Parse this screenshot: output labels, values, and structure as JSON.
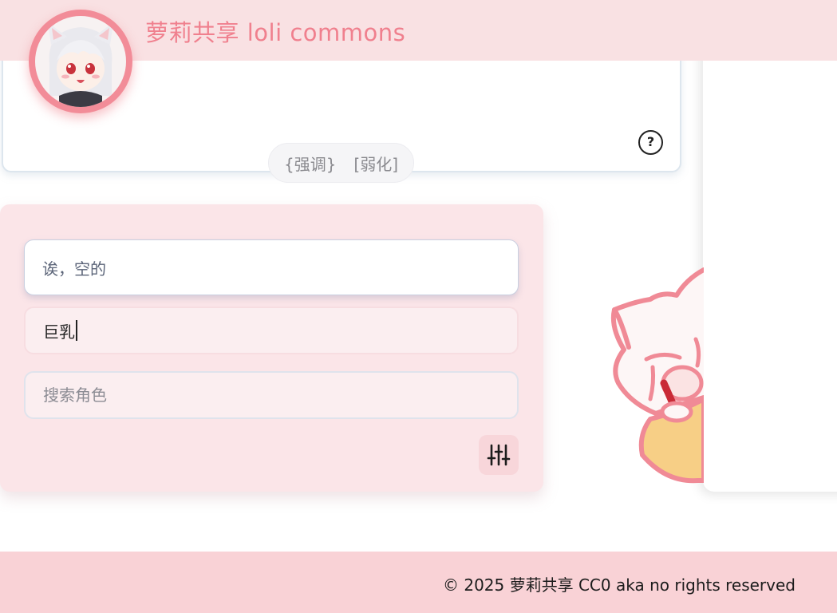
{
  "header": {
    "title": "萝莉共享 loli commons"
  },
  "syntax_hint": {
    "emphasize": "{强调}",
    "weaken": "[弱化]"
  },
  "help": {
    "label": "?"
  },
  "search": {
    "result_text": "诶，空的",
    "tag_input_value": "巨乳",
    "character_placeholder": "搜索角色"
  },
  "footer": {
    "text": "© 2025 萝莉共享 CC0 aka no rights reserved"
  },
  "colors": {
    "accent": "#f0808e",
    "header_bg": "#f9e1e3",
    "card_bg": "#fbe5e8",
    "footer_bg": "#f9d2d6"
  },
  "icons": {
    "help": "question-circle-icon",
    "filter": "sliders-icon"
  }
}
